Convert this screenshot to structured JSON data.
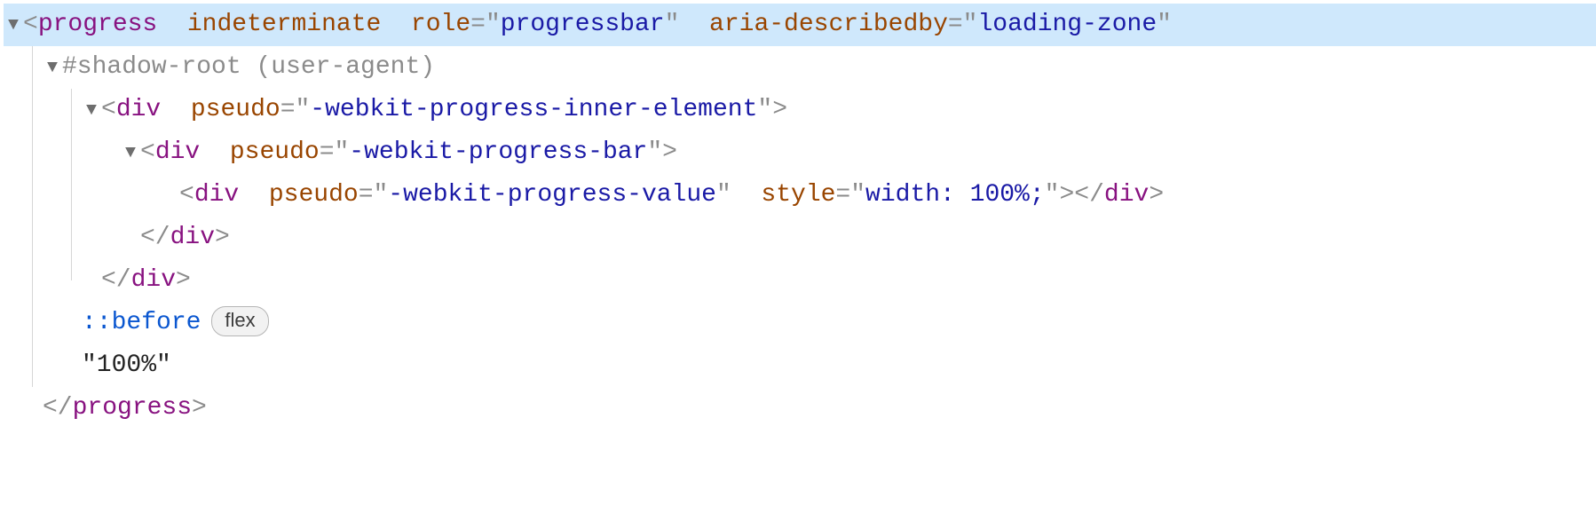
{
  "line0": {
    "tag": "progress",
    "attr1_name": "indeterminate",
    "attr2_name": "role",
    "attr2_val": "progressbar",
    "attr3_name": "aria-describedby",
    "attr3_val": "loading-zone"
  },
  "line1": {
    "text": "#shadow-root (user-agent)"
  },
  "line2": {
    "tag": "div",
    "attr_name": "pseudo",
    "attr_val": "-webkit-progress-inner-element"
  },
  "line3": {
    "tag": "div",
    "attr_name": "pseudo",
    "attr_val": "-webkit-progress-bar"
  },
  "line4": {
    "tag": "div",
    "attr1_name": "pseudo",
    "attr1_val": "-webkit-progress-value",
    "attr2_name": "style",
    "attr2_val": "width: 100%;"
  },
  "line5": {
    "tag": "div"
  },
  "line6": {
    "tag": "div"
  },
  "line7": {
    "pseudo": "::before",
    "badge": "flex"
  },
  "line8": {
    "text": "\"100%\""
  },
  "line9": {
    "tag": "progress"
  }
}
